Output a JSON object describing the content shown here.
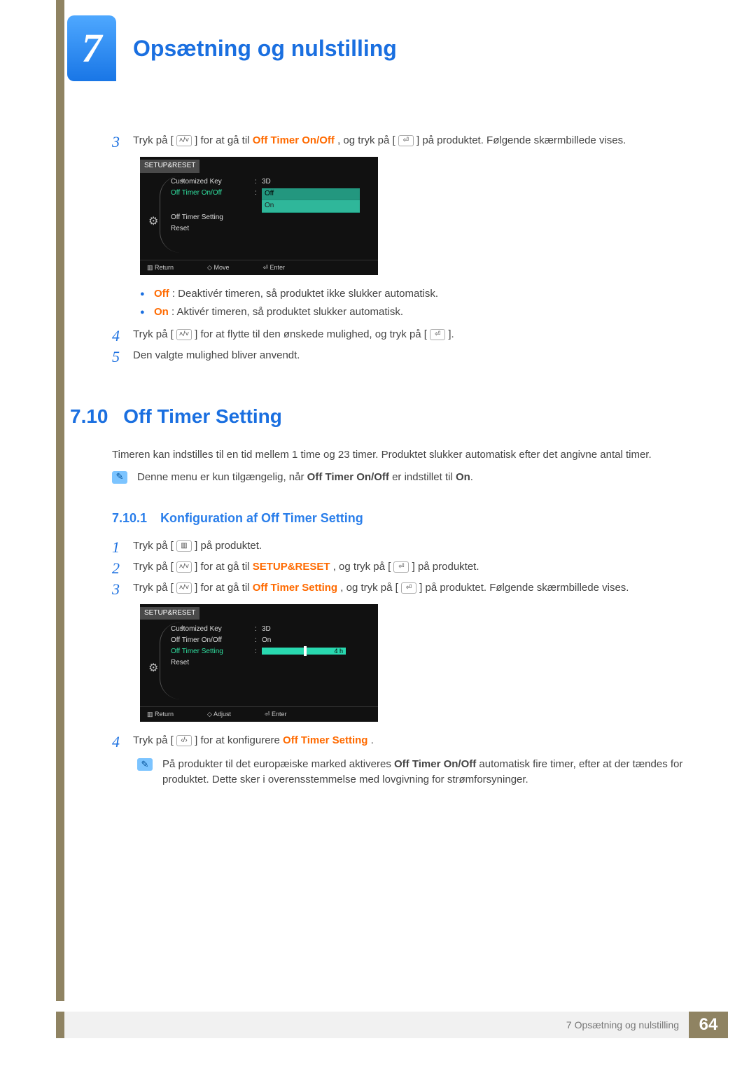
{
  "chapter": {
    "number": "7",
    "title": "Opsætning og nulstilling"
  },
  "steps_top": {
    "s3": {
      "pre": "Tryk på  [",
      "key1": "˄/˅",
      "mid1": "]  for at gå til ",
      "hl1": "Off Timer On/Off",
      "mid2": ", og tryk på [",
      "key2": "⏎",
      "mid3": "] på produktet. Følgende skærmbillede vises."
    },
    "bullets": {
      "off_label": "Off",
      "off_txt": ": Deaktivér timeren, så produktet ikke slukker automatisk.",
      "on_label": "On",
      "on_txt": ": Aktivér timeren, så produktet slukker automatisk."
    },
    "s4": {
      "pre": "Tryk på  [",
      "key1": "˄/˅",
      "mid1": "]  for at flytte til den ønskede mulighed, og tryk på [",
      "key2": "⏎",
      "post": "]."
    },
    "s5": "Den valgte mulighed bliver anvendt."
  },
  "osd1": {
    "title": "SETUP&RESET",
    "rows": [
      {
        "label": "Customized Key",
        "val": "3D"
      },
      {
        "label": "Off Timer On/Off",
        "val": "Off",
        "active": true
      },
      {
        "label": "Off Timer Setting",
        "val": ""
      },
      {
        "label": "Reset",
        "val": ""
      }
    ],
    "dropdown": [
      "Off",
      "On"
    ],
    "nav": {
      "return": "Return",
      "center": "Move",
      "enter": "Enter"
    }
  },
  "sec": {
    "no": "7.10",
    "title": "Off Timer Setting"
  },
  "sec_para": "Timeren kan indstilles til en tid mellem 1 time og 23 timer. Produktet slukker automatisk efter det angivne antal timer.",
  "sec_note": {
    "pre": "Denne menu er kun tilgængelig, når ",
    "b1": "Off Timer On",
    "slash": "/",
    "b2": "Off",
    "mid": " er indstillet til ",
    "b3": "On",
    "post": "."
  },
  "sub": {
    "no": "7.10.1",
    "title": "Konfiguration af Off Timer Setting"
  },
  "steps_bottom": {
    "s1": {
      "pre": "Tryk på  [ ",
      "key": "▥",
      "post": " ]  på produktet."
    },
    "s2": {
      "pre": "Tryk på  [",
      "key1": "˄/˅",
      "mid1": "]  for at gå til ",
      "hl": "SETUP&RESET",
      "mid2": ", og tryk på [",
      "key2": "⏎",
      "post": "] på produktet."
    },
    "s3": {
      "pre": "Tryk på  [",
      "key1": "˄/˅",
      "mid1": "]  for at gå til ",
      "hl": "Off Timer Setting",
      "mid2": ", og tryk på [",
      "key2": "⏎",
      "post": "] på produktet. Følgende skærmbillede vises."
    },
    "s4": {
      "pre": "Tryk på  [",
      "key": "‹/›",
      "mid": "]  for at konfigurere ",
      "hl": "Off Timer Setting",
      "post": "."
    }
  },
  "osd2": {
    "title": "SETUP&RESET",
    "rows": [
      {
        "label": "Customized Key",
        "val": "3D"
      },
      {
        "label": "Off Timer On/Off",
        "val": "On"
      },
      {
        "label": "Off Timer Setting",
        "val": "4 h",
        "active": true,
        "slider": true
      },
      {
        "label": "Reset",
        "val": ""
      }
    ],
    "nav": {
      "return": "Return",
      "center": "Adjust",
      "enter": "Enter"
    }
  },
  "note2": {
    "pre": "På produkter til det europæiske marked aktiveres ",
    "b1": "Off Timer On",
    "slash": "/",
    "b2": "Off",
    "post": " automatisk fire timer, efter at der tændes for produktet. Dette sker i overensstemmelse med lovgivning for strømforsyninger."
  },
  "footer": {
    "text": "7 Opsætning og nulstilling",
    "page": "64"
  }
}
